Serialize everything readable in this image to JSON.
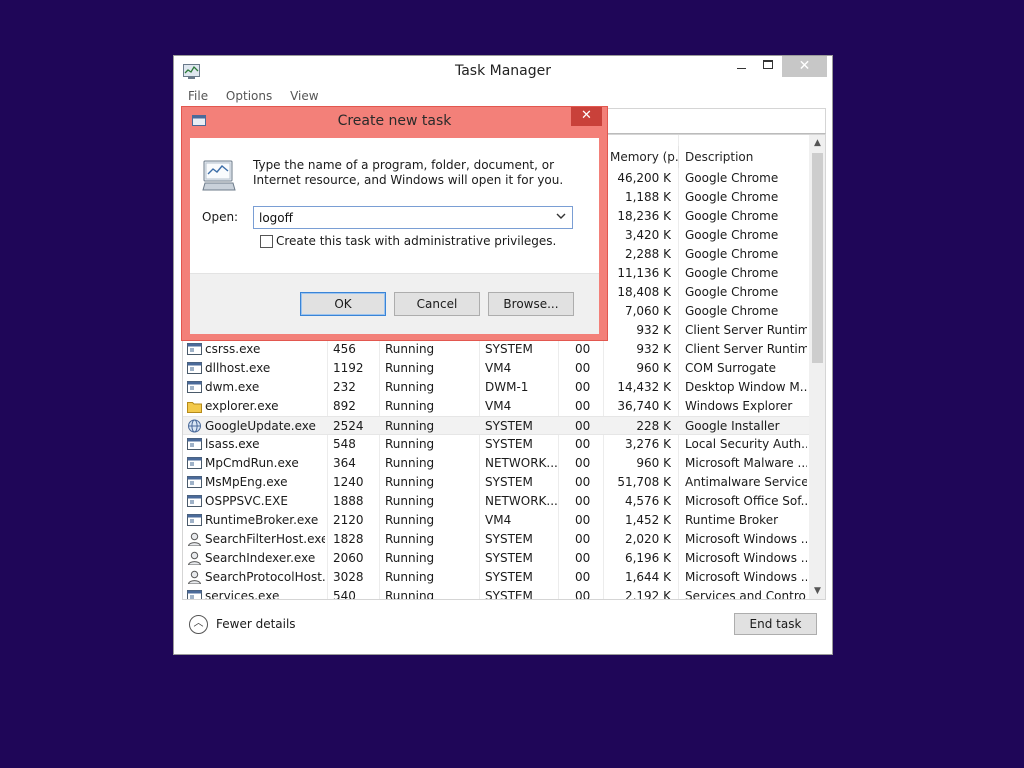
{
  "task_manager": {
    "title": "Task Manager",
    "controls": {
      "minimize": "",
      "maximize": "",
      "close": "✕"
    },
    "menu": [
      "File",
      "Options",
      "View"
    ],
    "columns": {
      "name": "",
      "pid": "",
      "status": "",
      "user": "",
      "cpu": "",
      "memory": "Memory (p...",
      "description": "Description"
    },
    "rows": [
      {
        "name": "",
        "pid": "",
        "status": "",
        "user": "",
        "cpu": "",
        "memory": "46,200 K",
        "description": "Google Chrome",
        "icon": "exe-icon"
      },
      {
        "name": "",
        "pid": "",
        "status": "",
        "user": "",
        "cpu": "",
        "memory": "1,188 K",
        "description": "Google Chrome",
        "icon": "exe-icon"
      },
      {
        "name": "",
        "pid": "",
        "status": "",
        "user": "",
        "cpu": "",
        "memory": "18,236 K",
        "description": "Google Chrome",
        "icon": "exe-icon"
      },
      {
        "name": "",
        "pid": "",
        "status": "",
        "user": "",
        "cpu": "",
        "memory": "3,420 K",
        "description": "Google Chrome",
        "icon": "exe-icon"
      },
      {
        "name": "",
        "pid": "",
        "status": "",
        "user": "",
        "cpu": "",
        "memory": "2,288 K",
        "description": "Google Chrome",
        "icon": "exe-icon"
      },
      {
        "name": "",
        "pid": "",
        "status": "",
        "user": "",
        "cpu": "",
        "memory": "11,136 K",
        "description": "Google Chrome",
        "icon": "exe-icon"
      },
      {
        "name": "",
        "pid": "",
        "status": "",
        "user": "",
        "cpu": "",
        "memory": "18,408 K",
        "description": "Google Chrome",
        "icon": "exe-icon"
      },
      {
        "name": "",
        "pid": "",
        "status": "",
        "user": "",
        "cpu": "",
        "memory": "7,060 K",
        "description": "Google Chrome",
        "icon": "exe-icon"
      },
      {
        "name": "",
        "pid": "",
        "status": "",
        "user": "",
        "cpu": "",
        "memory": "932 K",
        "description": "Client Server Runtim...",
        "icon": "exe-icon"
      },
      {
        "name": "csrss.exe",
        "pid": "456",
        "status": "Running",
        "user": "SYSTEM",
        "cpu": "00",
        "memory": "932 K",
        "description": "Client Server Runtim...",
        "icon": "exe-icon"
      },
      {
        "name": "dllhost.exe",
        "pid": "1192",
        "status": "Running",
        "user": "VM4",
        "cpu": "00",
        "memory": "960 K",
        "description": "COM Surrogate",
        "icon": "exe-icon"
      },
      {
        "name": "dwm.exe",
        "pid": "232",
        "status": "Running",
        "user": "DWM-1",
        "cpu": "00",
        "memory": "14,432 K",
        "description": "Desktop Window M...",
        "icon": "exe-icon"
      },
      {
        "name": "explorer.exe",
        "pid": "892",
        "status": "Running",
        "user": "VM4",
        "cpu": "00",
        "memory": "36,740 K",
        "description": "Windows Explorer",
        "icon": "folder-icon"
      },
      {
        "name": "GoogleUpdate.exe",
        "pid": "2524",
        "status": "Running",
        "user": "SYSTEM",
        "cpu": "00",
        "memory": "228 K",
        "description": "Google Installer",
        "icon": "globe-icon",
        "highlighted": true
      },
      {
        "name": "lsass.exe",
        "pid": "548",
        "status": "Running",
        "user": "SYSTEM",
        "cpu": "00",
        "memory": "3,276 K",
        "description": "Local Security Auth...",
        "icon": "exe-icon"
      },
      {
        "name": "MpCmdRun.exe",
        "pid": "364",
        "status": "Running",
        "user": "NETWORK...",
        "cpu": "00",
        "memory": "960 K",
        "description": "Microsoft Malware ...",
        "icon": "exe-icon"
      },
      {
        "name": "MsMpEng.exe",
        "pid": "1240",
        "status": "Running",
        "user": "SYSTEM",
        "cpu": "00",
        "memory": "51,708 K",
        "description": "Antimalware Service...",
        "icon": "exe-icon"
      },
      {
        "name": "OSPPSVC.EXE",
        "pid": "1888",
        "status": "Running",
        "user": "NETWORK...",
        "cpu": "00",
        "memory": "4,576 K",
        "description": "Microsoft Office Sof...",
        "icon": "exe-icon"
      },
      {
        "name": "RuntimeBroker.exe",
        "pid": "2120",
        "status": "Running",
        "user": "VM4",
        "cpu": "00",
        "memory": "1,452 K",
        "description": "Runtime Broker",
        "icon": "exe-icon"
      },
      {
        "name": "SearchFilterHost.exe",
        "pid": "1828",
        "status": "Running",
        "user": "SYSTEM",
        "cpu": "00",
        "memory": "2,020 K",
        "description": "Microsoft Windows ...",
        "icon": "user-search-icon"
      },
      {
        "name": "SearchIndexer.exe",
        "pid": "2060",
        "status": "Running",
        "user": "SYSTEM",
        "cpu": "00",
        "memory": "6,196 K",
        "description": "Microsoft Windows ...",
        "icon": "user-search-icon"
      },
      {
        "name": "SearchProtocolHost....",
        "pid": "3028",
        "status": "Running",
        "user": "SYSTEM",
        "cpu": "00",
        "memory": "1,644 K",
        "description": "Microsoft Windows ...",
        "icon": "user-search-icon"
      },
      {
        "name": "services.exe",
        "pid": "540",
        "status": "Running",
        "user": "SYSTEM",
        "cpu": "00",
        "memory": "2,192 K",
        "description": "Services and Control...",
        "icon": "exe-icon"
      }
    ],
    "footer": {
      "fewer_details": "Fewer details",
      "end_task": "End task"
    }
  },
  "dialog": {
    "title": "Create new task",
    "close": "✕",
    "description": "Type the name of a program, folder, document, or Internet resource, and Windows will open it for you.",
    "open_label": "Open:",
    "open_value": "logoff",
    "admin_checkbox_label": "Create this task with administrative privileges.",
    "admin_checked": false,
    "buttons": {
      "ok": "OK",
      "cancel": "Cancel",
      "browse": "Browse..."
    }
  },
  "colors": {
    "desktop": "#1f0658",
    "dialog_frame": "#f38079",
    "dialog_close": "#c9413a",
    "ok_focus": "#3a84d6"
  }
}
